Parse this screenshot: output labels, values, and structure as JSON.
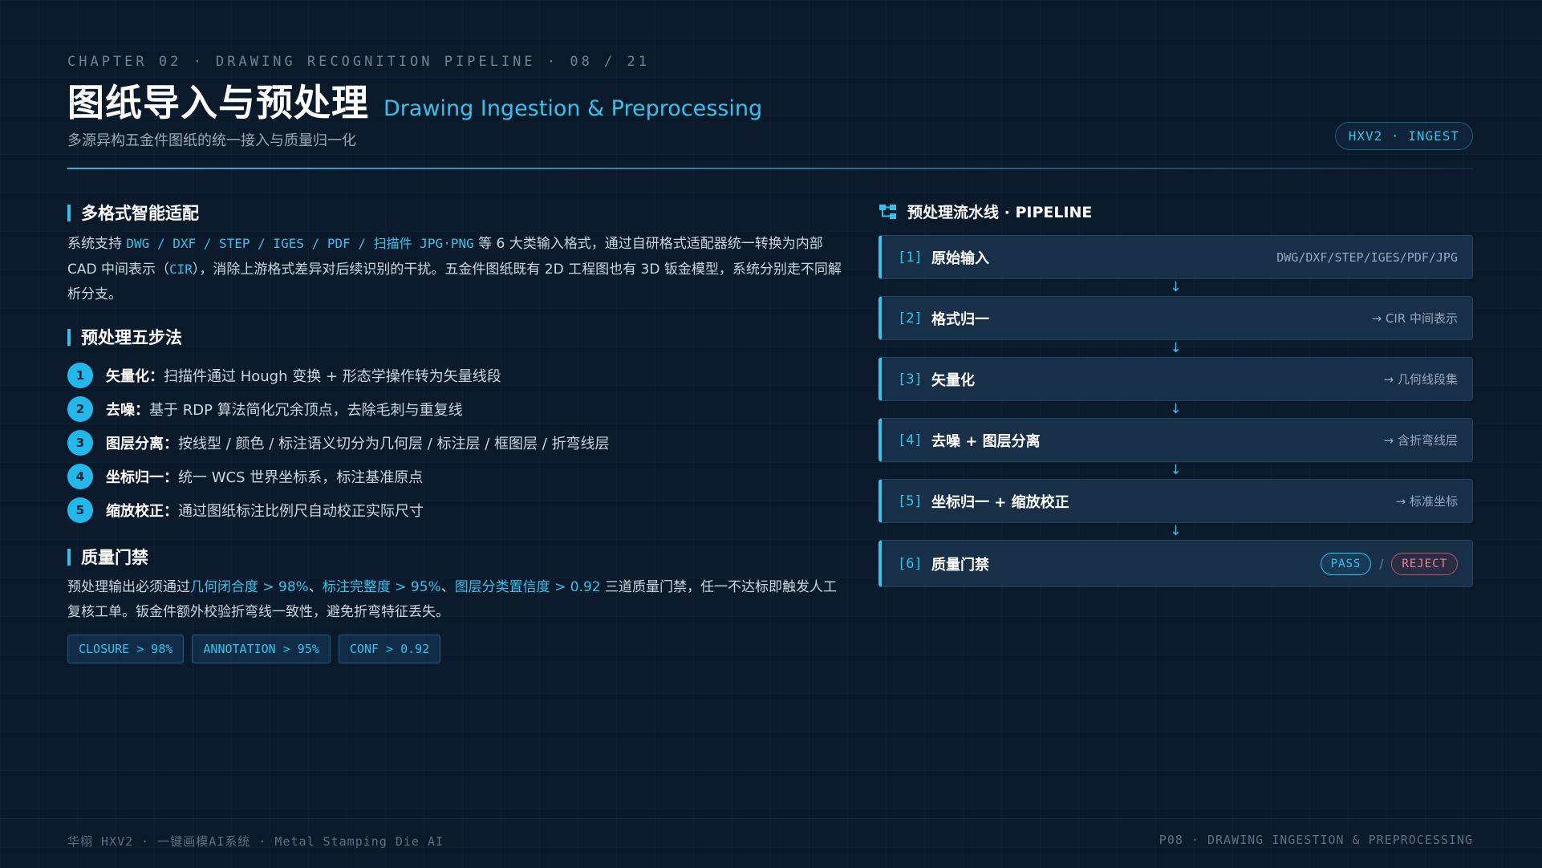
{
  "header": {
    "chapter": "CHAPTER 02 · DRAWING RECOGNITION PIPELINE · 08 / 21",
    "title_zh": "图纸导入与预处理",
    "title_en": "Drawing Ingestion & Preprocessing",
    "subtitle": "多源异构五金件图纸的统一接入与质量归一化",
    "badge": "HXV2 · INGEST"
  },
  "section1": {
    "title": "多格式智能适配",
    "p1_a": "系统支持 ",
    "p1_formats": "DWG / DXF / STEP / IGES / PDF / 扫描件 JPG·PNG",
    "p1_b": " 等 6 大类输入格式，通过自研格式适配器统一转换为内部 CAD 中间表示（",
    "p1_cir": "CIR",
    "p1_c": "），消除上游格式差异对后续识别的干扰。五金件图纸既有 2D 工程图也有 3D 钣金模型，系统分别走不同解析分支。"
  },
  "section2": {
    "title": "预处理五步法",
    "steps": [
      {
        "num": "1",
        "label": "矢量化：",
        "text": "扫描件通过 Hough 变换 + 形态学操作转为矢量线段"
      },
      {
        "num": "2",
        "label": "去噪：",
        "text": "基于 RDP 算法简化冗余顶点，去除毛刺与重复线"
      },
      {
        "num": "3",
        "label": "图层分离：",
        "text": "按线型 / 颜色 / 标注语义切分为几何层 / 标注层 / 框图层 / 折弯线层"
      },
      {
        "num": "4",
        "label": "坐标归一：",
        "text": "统一 WCS 世界坐标系，标注基准原点"
      },
      {
        "num": "5",
        "label": "缩放校正：",
        "text": "通过图纸标注比例尺自动校正实际尺寸"
      }
    ]
  },
  "section3": {
    "title": "质量门禁",
    "p_a": "预处理输出必须通过",
    "m1": "几何闭合度 > 98%",
    "sep1": "、",
    "m2": "标注完整度 > 95%",
    "sep2": "、",
    "m3": "图层分类置信度 > 0.92",
    "p_b": " 三道质量门禁，任一不达标即触发人工复核工单。钣金件额外校验折弯线一致性，避免折弯特征丢失。",
    "tags": [
      "CLOSURE > 98%",
      "ANNOTATION > 95%",
      "CONF > 0.92"
    ]
  },
  "pipeline": {
    "title": "预处理流水线 · PIPELINE",
    "arrow": "↓",
    "stages": [
      {
        "idx": "[1]",
        "name": "原始输入",
        "note": "DWG/DXF/STEP/IGES/PDF/JPG"
      },
      {
        "idx": "[2]",
        "name": "格式归一",
        "note": "→ CIR 中间表示"
      },
      {
        "idx": "[3]",
        "name": "矢量化",
        "note": "→ 几何线段集"
      },
      {
        "idx": "[4]",
        "name": "去噪 + 图层分离",
        "note": "→ 含折弯线层"
      },
      {
        "idx": "[5]",
        "name": "坐标归一 + 缩放校正",
        "note": "→ 标准坐标"
      },
      {
        "idx": "[6]",
        "name": "质量门禁",
        "pass": "PASS",
        "slash": "/",
        "reject": "REJECT"
      }
    ]
  },
  "footer": {
    "left": "华栩 HXV2 · 一键画模AI系统 · Metal Stamping Die AI",
    "right": "P08 · DRAWING INGESTION & PREPROCESSING"
  },
  "colors": {
    "accent": "#2fc4ee",
    "background": "#0b1a2b",
    "reject": "#e58895"
  }
}
